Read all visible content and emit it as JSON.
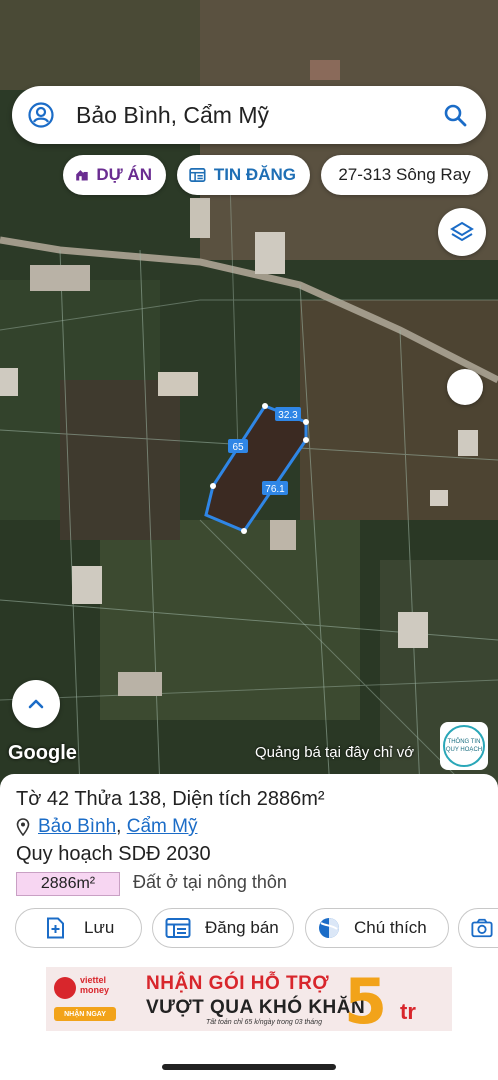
{
  "search": {
    "query": "Bảo Bình, Cẩm Mỹ"
  },
  "chips": [
    {
      "label": "DỰ ÁN",
      "icon": "home-building-icon",
      "color": "#6a2c91"
    },
    {
      "label": "TIN ĐĂNG",
      "icon": "listing-board-icon",
      "color": "#1f6fb5"
    },
    {
      "label": "27-313 Sông Ray",
      "icon": "",
      "color": "#222222"
    }
  ],
  "map": {
    "parcel_edges": [
      "32.3",
      "65",
      "76.1"
    ],
    "parcel_outline_color": "#2f86e6",
    "attribution": "Google",
    "ad_line": "Quảng bá tại đây chỉ vớ",
    "info_badge": [
      "THÔNG TIN",
      "QUY HOẠCH"
    ]
  },
  "sheet": {
    "title": "Tờ 42 Thửa 138, Diện tích 2886m²",
    "ward": "Bảo Bình",
    "separator": ", ",
    "district": "Cẩm Mỹ",
    "plan": "Quy hoạch SDĐ 2030",
    "area_badge": "2886m²",
    "area_badge_color": "#f7d6f2",
    "land_use": "Đất ở tại nông thôn",
    "actions": [
      {
        "label": "Lưu",
        "icon": "add-file-icon"
      },
      {
        "label": "Đăng bán",
        "icon": "listing-icon"
      },
      {
        "label": "Chú thích",
        "icon": "legend-icon"
      },
      {
        "label": "",
        "icon": "camera-icon"
      }
    ]
  },
  "ad": {
    "brand": [
      "viettel",
      "money"
    ],
    "cta": "NHẬN NGAY",
    "headline1": "NHẬN GÓI HỖ TRỢ",
    "headline2": "VƯỢT QUA KHÓ KHĂN",
    "fine_print": "Tất toán chỉ 65 k/ngày trong 03 tháng",
    "amount": "5",
    "unit": "tr"
  }
}
